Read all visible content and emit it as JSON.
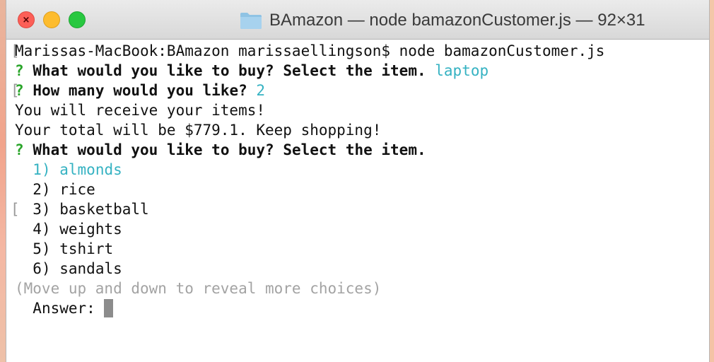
{
  "window": {
    "title": "BAmazon — node bamazonCustomer.js — 92×31",
    "folder_icon": "folder-icon",
    "buttons": {
      "close_icon": "close-icon",
      "close_glyph": "×",
      "minimize_icon": "minimize-icon",
      "zoom_icon": "zoom-icon"
    }
  },
  "colors": {
    "prompt_mark": "#2aa52a",
    "answer_highlight": "#35b2c2",
    "hint_text": "#a3a3a3",
    "close": "#fc5f57",
    "minimize": "#fdbc2e",
    "zoom": "#28c840"
  },
  "terminal": {
    "command_line": "Marissas-MacBook:BAmazon marissaellingson$ node bamazonCustomer.js",
    "mark_char": "[",
    "q1": {
      "mark": "?",
      "question": "What would you like to buy? Select the item.",
      "answer": "laptop"
    },
    "q2": {
      "mark": "?",
      "question": "How many would you like?",
      "answer": "2"
    },
    "message1": "You will receive your items!",
    "message2": "Your total will be $779.1. Keep shopping!",
    "q3": {
      "mark": "?",
      "question": "What would you like to buy? Select the item."
    },
    "choices": [
      {
        "number": "1)",
        "label": "almonds"
      },
      {
        "number": "2)",
        "label": "rice"
      },
      {
        "number": "3)",
        "label": "basketball"
      },
      {
        "number": "4)",
        "label": "weights"
      },
      {
        "number": "5)",
        "label": "tshirt"
      },
      {
        "number": "6)",
        "label": "sandals"
      }
    ],
    "selected_choice_index": 0,
    "hint": "(Move up and down to reveal more choices)",
    "answer_label": "Answer:"
  }
}
